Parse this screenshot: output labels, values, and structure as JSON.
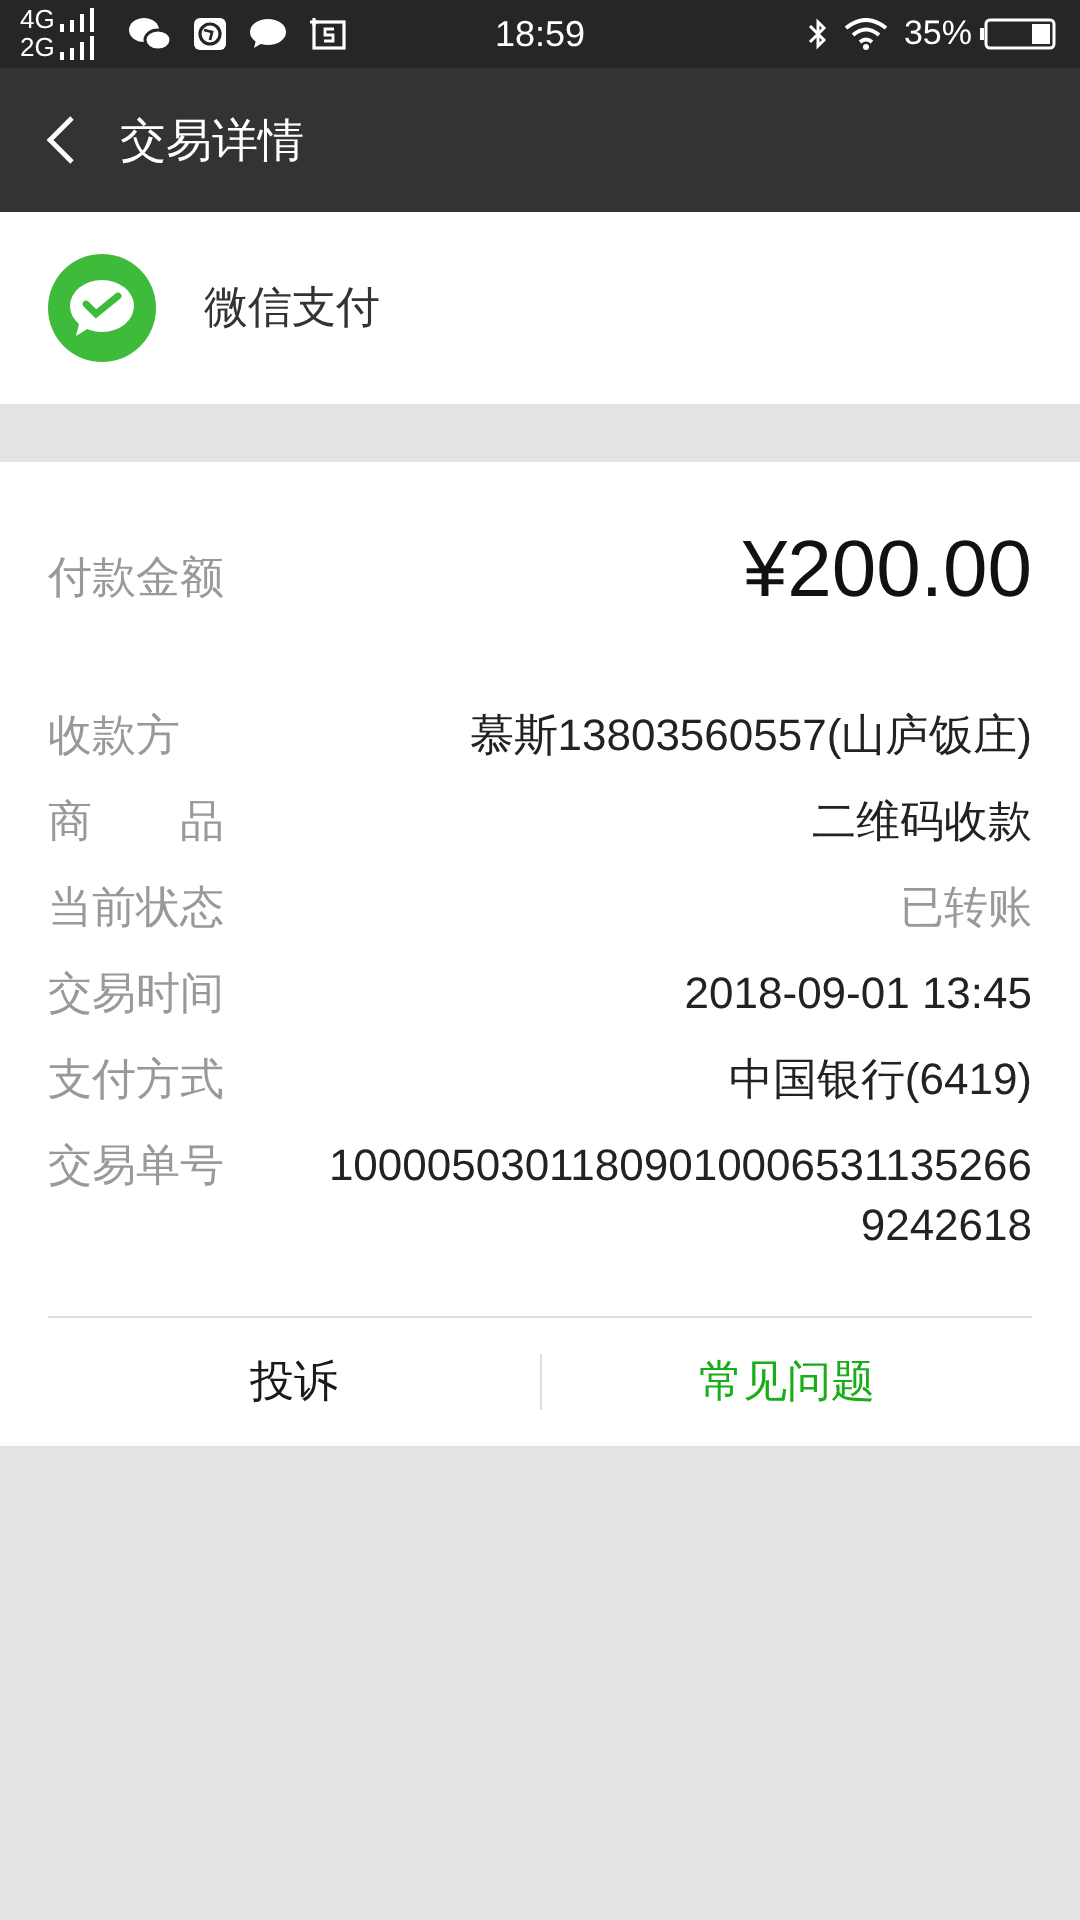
{
  "status_bar": {
    "network_top": "4G",
    "network_bottom": "2G",
    "time": "18:59",
    "battery": "35%"
  },
  "nav": {
    "title": "交易详情"
  },
  "merchant": {
    "name": "微信支付"
  },
  "amount": {
    "label": "付款金额",
    "value": "¥200.00"
  },
  "details": [
    {
      "label": "收款方",
      "value": "慕斯13803560557(山庐饭庄)",
      "muted": false
    },
    {
      "label": "商　　品",
      "value": "二维码收款",
      "muted": false
    },
    {
      "label": "当前状态",
      "value": "已转账",
      "muted": true
    },
    {
      "label": "交易时间",
      "value": "2018-09-01 13:45",
      "muted": false
    },
    {
      "label": "支付方式",
      "value": "中国银行(6419)",
      "muted": false
    },
    {
      "label": "交易单号",
      "value": "100005030118090100065311352669242618",
      "muted": false
    }
  ],
  "actions": [
    {
      "label": "投诉",
      "color": "#1a1a1a"
    },
    {
      "label": "常见问题",
      "color": "#1aad19"
    }
  ]
}
